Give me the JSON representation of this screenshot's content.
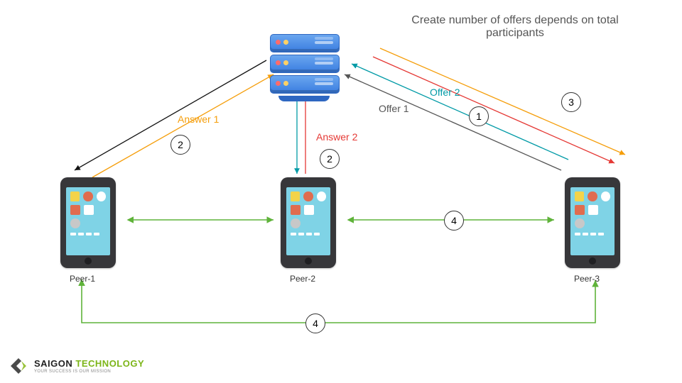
{
  "caption": "Create number of offers depends on total participants",
  "peers": {
    "p1": "Peer-1",
    "p2": "Peer-2",
    "p3": "Peer-3"
  },
  "labels": {
    "answer1": "Answer 1",
    "answer2": "Answer 2",
    "offer1": "Offer 1",
    "offer2": "Offer 2"
  },
  "steps": {
    "offers": "1",
    "answer_p1": "2",
    "answer_p2": "2",
    "distribute": "3",
    "p2p": "4",
    "p2p_bottom": "4"
  },
  "colors": {
    "answer1": "#f59e0b",
    "answer2": "#e53935",
    "offer1": "#555555",
    "offer2": "#009aa6",
    "p2p": "#5fb33a",
    "serverReturn": "#111111"
  },
  "logo": {
    "main": "SAIGON",
    "accent": "TECHNOLOGY",
    "sub": "YOUR SUCCESS IS OUR MISSION"
  }
}
